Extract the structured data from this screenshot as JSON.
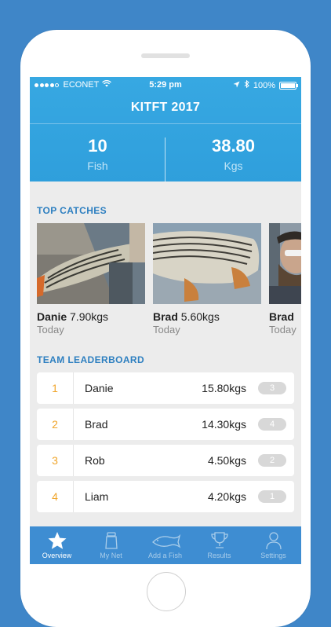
{
  "status": {
    "carrier": "ECONET",
    "time": "5:29 pm",
    "battery": "100%"
  },
  "header": {
    "title": "KITFT 2017",
    "stats": [
      {
        "value": "10",
        "label": "Fish"
      },
      {
        "value": "38.80",
        "label": "Kgs"
      }
    ]
  },
  "top_catches": {
    "title": "TOP CATCHES",
    "items": [
      {
        "name": "Danie",
        "weight": "7.90kgs",
        "date": "Today"
      },
      {
        "name": "Brad",
        "weight": "5.60kgs",
        "date": "Today"
      },
      {
        "name": "Brad",
        "weight": "",
        "date": "Today"
      }
    ]
  },
  "leaderboard": {
    "title": "TEAM LEADERBOARD",
    "rows": [
      {
        "rank": "1",
        "name": "Danie",
        "weight": "15.80kgs",
        "count": "3"
      },
      {
        "rank": "2",
        "name": "Brad",
        "weight": "14.30kgs",
        "count": "4"
      },
      {
        "rank": "3",
        "name": "Rob",
        "weight": "4.50kgs",
        "count": "2"
      },
      {
        "rank": "4",
        "name": "Liam",
        "weight": "4.20kgs",
        "count": "1"
      }
    ]
  },
  "tabs": [
    {
      "label": "Overview",
      "icon": "star-icon",
      "active": true
    },
    {
      "label": "My Net",
      "icon": "net-icon",
      "active": false
    },
    {
      "label": "Add a Fish",
      "icon": "fish-icon",
      "active": false
    },
    {
      "label": "Results",
      "icon": "trophy-icon",
      "active": false
    },
    {
      "label": "Settings",
      "icon": "person-icon",
      "active": false
    }
  ]
}
